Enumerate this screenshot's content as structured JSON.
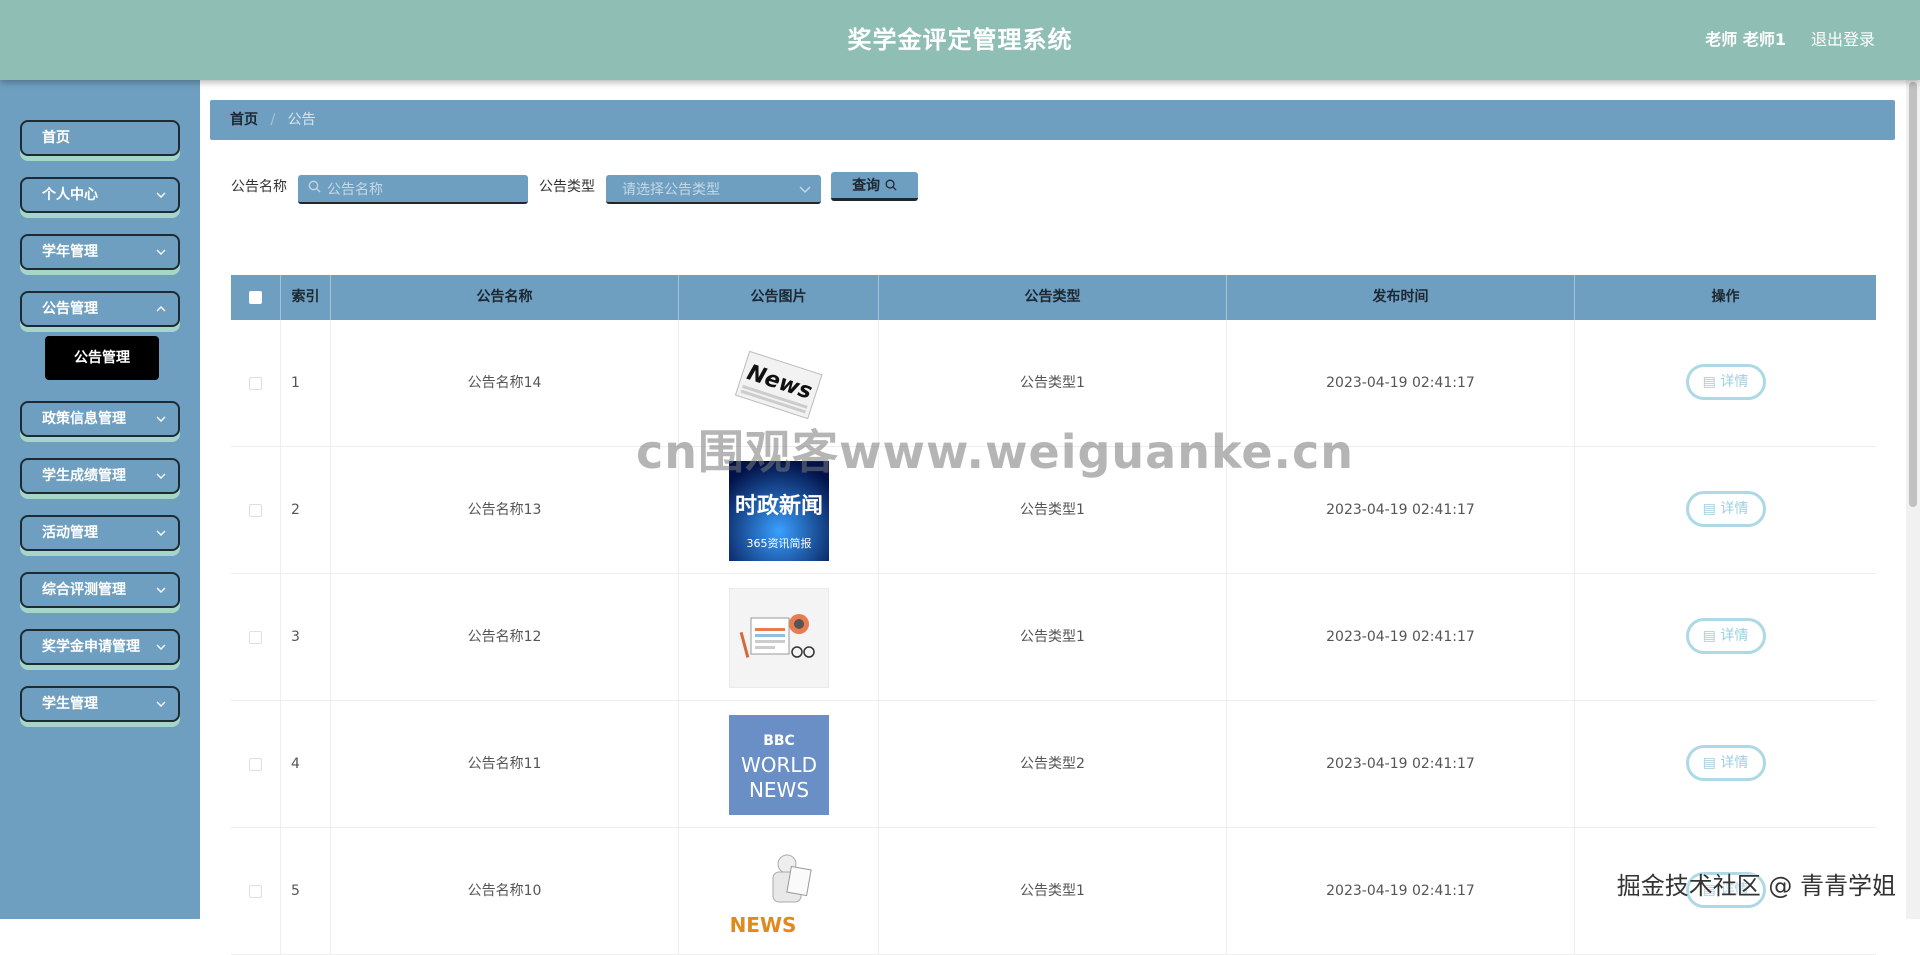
{
  "header": {
    "title": "奖学金评定管理系统",
    "user": "老师 老师1",
    "logout": "退出登录",
    "bg_color": "#8fbfb4"
  },
  "sidebar": {
    "bg_color": "#6f9fc0",
    "items": [
      {
        "label": "首页",
        "has_chevron": false
      },
      {
        "label": "个人中心",
        "has_chevron": true
      },
      {
        "label": "学年管理",
        "has_chevron": true
      },
      {
        "label": "公告管理",
        "has_chevron": true
      },
      {
        "label": "政策信息管理",
        "has_chevron": true
      },
      {
        "label": "学生成绩管理",
        "has_chevron": true
      },
      {
        "label": "活动管理",
        "has_chevron": true
      },
      {
        "label": "综合评测管理",
        "has_chevron": true
      },
      {
        "label": "奖学金申请管理",
        "has_chevron": true
      },
      {
        "label": "学生管理",
        "has_chevron": true
      }
    ],
    "active_sub": "公告管理"
  },
  "breadcrumb": {
    "home": "首页",
    "separator": "/",
    "current": "公告"
  },
  "search": {
    "name_label": "公告名称",
    "name_placeholder": "公告名称",
    "type_label": "公告类型",
    "type_placeholder": "请选择公告类型",
    "query_button": "查询"
  },
  "table": {
    "headers": [
      "索引",
      "公告名称",
      "公告图片",
      "公告类型",
      "发布时间",
      "操作"
    ],
    "detail_label": "详情",
    "rows": [
      {
        "index": "1",
        "name": "公告名称14",
        "image": "news-paper",
        "type": "公告类型1",
        "time": "2023-04-19 02:41:17"
      },
      {
        "index": "2",
        "name": "公告名称13",
        "image": "shizheng-news",
        "type": "公告类型1",
        "time": "2023-04-19 02:41:17"
      },
      {
        "index": "3",
        "name": "公告名称12",
        "image": "news-illustration",
        "type": "公告类型1",
        "time": "2023-04-19 02:41:17"
      },
      {
        "index": "4",
        "name": "公告名称11",
        "image": "bbc-world-news",
        "type": "公告类型2",
        "time": "2023-04-19 02:41:17"
      },
      {
        "index": "5",
        "name": "公告名称10",
        "image": "news-figure",
        "type": "公告类型1",
        "time": "2023-04-19 02:41:17"
      }
    ]
  },
  "images": {
    "shizheng_title": "时政新闻",
    "shizheng_sub": "365资讯简报",
    "bbc_logo": "BBC",
    "bbc_line1": "WORLD",
    "bbc_line2": "NEWS",
    "news_word": "NEWS"
  },
  "watermarks": {
    "center": "cn围观客www.weiguanke.cn",
    "corner": "掘金技术社区 @ 青青学姐"
  }
}
